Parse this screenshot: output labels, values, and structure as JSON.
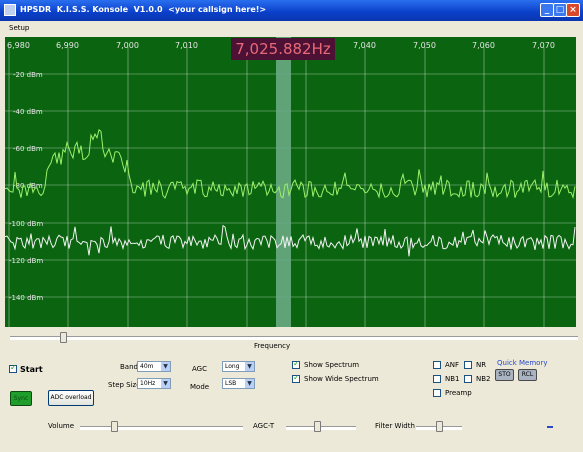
{
  "window": {
    "title": "HPSDR  K.I.S.S. Konsole  V1.0.0  <your callsign here!>"
  },
  "menu": {
    "setup": "Setup"
  },
  "display": {
    "frequency_readout": "7,025.882Hz",
    "freq_ticks": [
      "6,980",
      "6,990",
      "7,000",
      "7,010",
      "7,020",
      "7,030",
      "7,040",
      "7,050",
      "7,060",
      "7,070"
    ],
    "dbm_labels": [
      "-20 dBm",
      "-40 dBm",
      "-60 dBm",
      "-80 dBm",
      "-100 dBm",
      "-120 dBm",
      "-140 dBm"
    ],
    "colors": {
      "background": "#0a6410",
      "spectrum": "#9cf06a",
      "wide_spectrum": "#f0f0f0",
      "filter_band": "#6fae8a",
      "readout_bg": "#4d1136",
      "readout_fg": "#e86a78"
    }
  },
  "frequency_slider": {
    "label": "Frequency",
    "level": 0.09
  },
  "controls": {
    "start_label": "Start",
    "start_checked": true,
    "sync_label": "Sync",
    "adc_label": "ADC overload",
    "band_label": "Band",
    "band_value": "40m",
    "step_label": "Step Size",
    "step_value": "10Hz",
    "agc_label": "AGC",
    "agc_value": "Long",
    "mode_label": "Mode",
    "mode_value": "LSB",
    "show_spectrum_label": "Show Spectrum",
    "show_spectrum_checked": true,
    "show_wide_label": "Show Wide Spectrum",
    "show_wide_checked": true,
    "anf_label": "ANF",
    "nr_label": "NR",
    "nb1_label": "NB1",
    "nb2_label": "NB2",
    "preamp_label": "Preamp",
    "quick_memory_label": "Quick Memory",
    "sto_label": "STO",
    "rcl_label": "RCL"
  },
  "sliders": {
    "volume_label": "Volume",
    "volume_level": 0.2,
    "agct_label": "AGC-T",
    "agct_level": 0.45,
    "filter_label": "Filter Width",
    "filter_level": 0.5
  }
}
